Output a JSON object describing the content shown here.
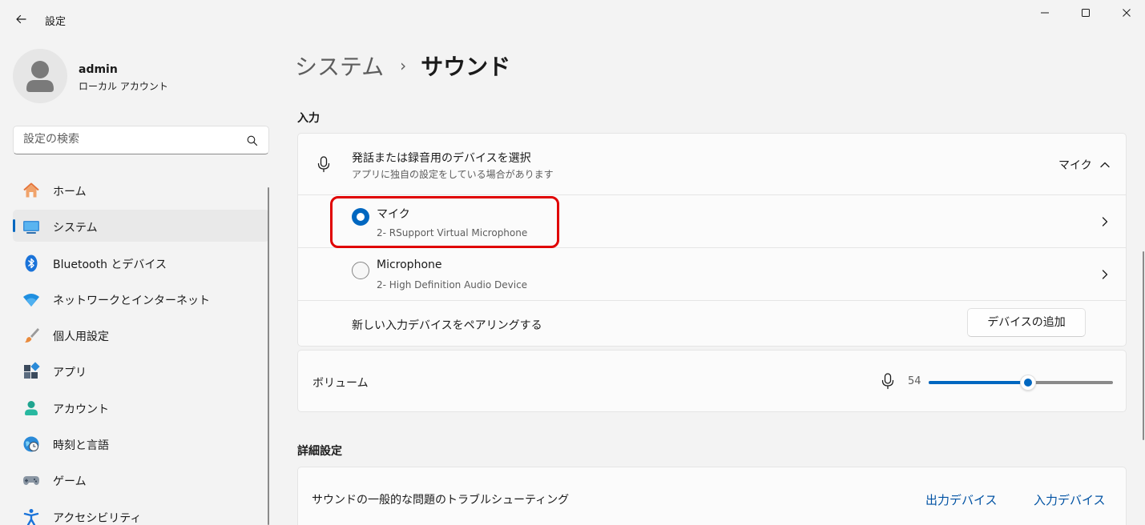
{
  "window": {
    "title": "設定",
    "back_icon": "back-arrow-icon",
    "controls": [
      "minimize-icon",
      "maximize-icon",
      "close-icon"
    ]
  },
  "profile": {
    "name": "admin",
    "account_type": "ローカル アカウント"
  },
  "search": {
    "placeholder": "設定の検索",
    "value": ""
  },
  "sidebar": {
    "items": [
      {
        "label": "ホーム",
        "icon": "home-icon"
      },
      {
        "label": "システム",
        "icon": "system-icon",
        "active": true
      },
      {
        "label": "Bluetooth とデバイス",
        "icon": "bluetooth-icon"
      },
      {
        "label": "ネットワークとインターネット",
        "icon": "wifi-icon"
      },
      {
        "label": "個人用設定",
        "icon": "paintbrush-icon"
      },
      {
        "label": "アプリ",
        "icon": "apps-icon"
      },
      {
        "label": "アカウント",
        "icon": "account-icon"
      },
      {
        "label": "時刻と言語",
        "icon": "time-language-icon"
      },
      {
        "label": "ゲーム",
        "icon": "gamepad-icon"
      },
      {
        "label": "アクセシビリティ",
        "icon": "accessibility-icon"
      }
    ]
  },
  "breadcrumb": {
    "parent": "システム",
    "separator": "›",
    "current": "サウンド"
  },
  "input_section": {
    "title": "入力",
    "device_select": {
      "title": "発話または録音用のデバイスを選択",
      "subtitle": "アプリに独自の設定をしている場合があります",
      "selected": "マイク"
    },
    "devices": [
      {
        "name": "マイク",
        "description": "2- RSupport Virtual Microphone",
        "selected": true
      },
      {
        "name": "Microphone",
        "description": "2- High Definition Audio Device",
        "selected": false
      }
    ],
    "pair": {
      "label": "新しい入力デバイスをペアリングする",
      "button": "デバイスの追加"
    },
    "volume": {
      "label": "ボリューム",
      "value": "54",
      "percent": 54
    }
  },
  "advanced": {
    "title": "詳細設定",
    "troubleshoot_label": "サウンドの一般的な問題のトラブルシューティング",
    "links": [
      "出力デバイス",
      "入力デバイス"
    ]
  },
  "colors": {
    "accent": "#0067c0",
    "highlight": "#e00000",
    "background": "#f3f3f3",
    "card": "#fbfbfb",
    "link": "#0052a3"
  }
}
